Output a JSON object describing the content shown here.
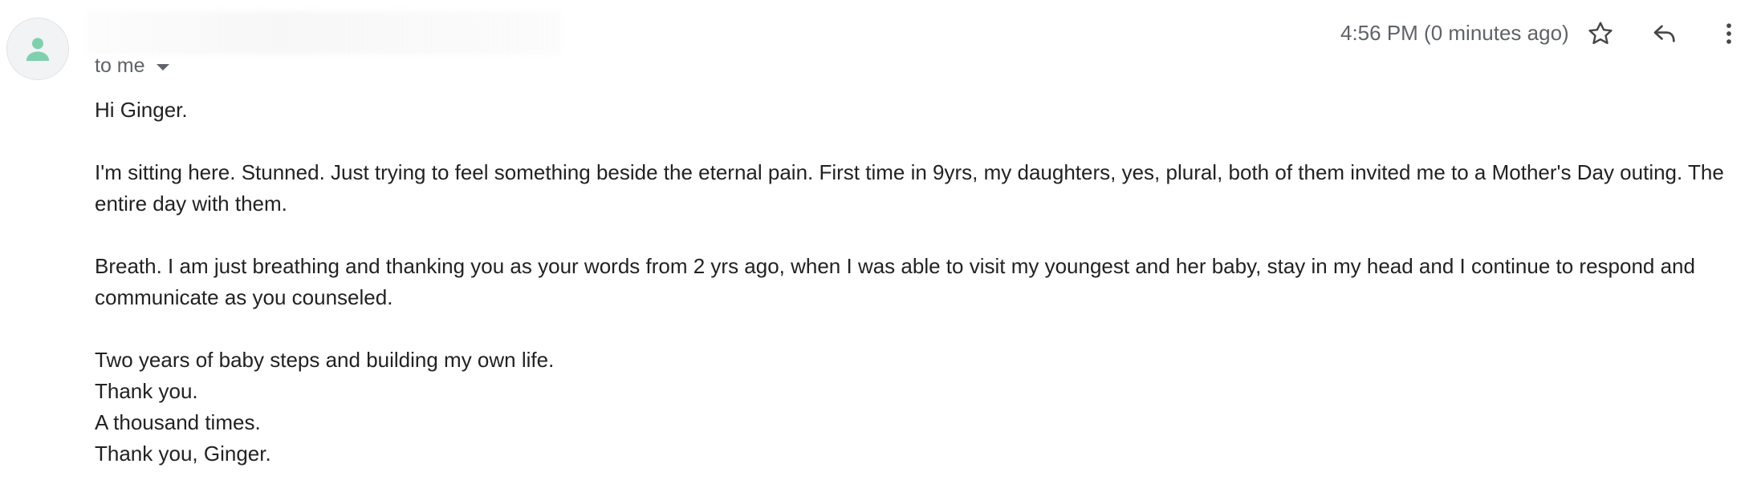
{
  "message": {
    "timestamp": "4:56 PM (0 minutes ago)",
    "recipient_label": "to me",
    "greeting": "Hi Ginger.",
    "paragraph1": "I'm sitting here. Stunned. Just trying to feel something beside the eternal pain. First time in 9yrs, my daughters, yes, plural, both of them invited me to a Mother's Day outing. The entire day with them.",
    "paragraph2": "Breath. I am just breathing and thanking you as your words from 2 yrs ago, when I was able to visit my youngest and her baby, stay in my head and I continue to respond and communicate as you counseled.",
    "line1": "Two years of baby steps and building my own life.",
    "line2": "Thank you.",
    "line3": "A thousand times.",
    "line4": "Thank you, Ginger."
  },
  "icons": {
    "avatar": "person-icon",
    "star": "star-icon",
    "reply": "reply-icon",
    "more": "more-vert-icon",
    "recipient_caret": "caret-down-icon"
  },
  "colors": {
    "avatar_fg": "#7fd1ae",
    "avatar_bg": "#f1f3f4",
    "meta_text": "#5f6368",
    "body_text": "#222222"
  }
}
